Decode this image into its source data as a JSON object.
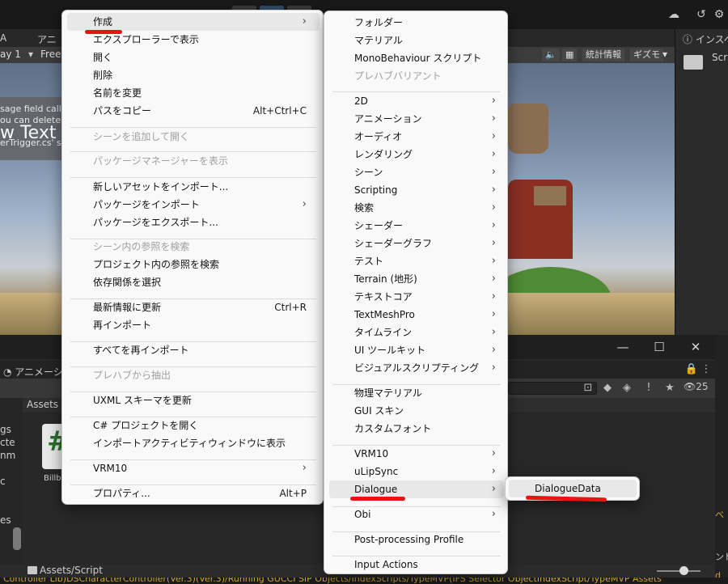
{
  "background": {
    "tabs": {
      "scene_frag": "A",
      "anim_frag": "アニ"
    },
    "gamebar": {
      "display_frag": "ay 1",
      "free_frag": "Free",
      "stats": "統計情報",
      "gizmo": "ギズモ"
    },
    "inspector": {
      "title": "インスペ",
      "script_frag": "Scr"
    },
    "scene_overlay": {
      "lines": [
        "sage field calle",
        "ou can delete i",
        "",
        "erTrigger.cs' s"
      ],
      "big_text": "w Text"
    },
    "project": {
      "anim_tab": "アニメーショ",
      "assets_label": "Assets",
      "asset_name": "Billb",
      "count": "25",
      "path": "Assets/Script",
      "left_frags": [
        "gs",
        "cte",
        "nm",
        "c",
        "es"
      ],
      "right_frags": [
        "ベ",
        "ンド",
        "d"
      ],
      "console_text": "Controller Lib)DSCharacterController(Ver.3)(Ver.3)/Running GUCCI SIP Objects/IndexScripts/TypeMVP(IFS Selector ObjectIndexScript/TypeMVP Assets"
    }
  },
  "menu_main": {
    "items": [
      {
        "label": "作成",
        "arrow": true,
        "highlight": true
      },
      {
        "label": "エクスプローラーで表示"
      },
      {
        "label": "開く"
      },
      {
        "label": "削除"
      },
      {
        "label": "名前を変更"
      },
      {
        "label": "パスをコピー",
        "shortcut": "Alt+Ctrl+C"
      },
      {
        "label": "シーンを追加して開く",
        "disabled": true
      },
      {
        "label": "パッケージマネージャーを表示",
        "disabled": true
      },
      {
        "label": "新しいアセットをインポート..."
      },
      {
        "label": "パッケージをインポート",
        "arrow": true
      },
      {
        "label": "パッケージをエクスポート..."
      },
      {
        "label": "シーン内の参照を検索",
        "disabled": true
      },
      {
        "label": "プロジェクト内の参照を検索"
      },
      {
        "label": "依存関係を選択"
      },
      {
        "label": "最新情報に更新",
        "shortcut": "Ctrl+R"
      },
      {
        "label": "再インポート"
      },
      {
        "label": "すべてを再インポート"
      },
      {
        "label": "プレハブから抽出",
        "disabled": true
      },
      {
        "label": "UXML スキーマを更新"
      },
      {
        "label": "C# プロジェクトを開く"
      },
      {
        "label": "インポートアクティビティウィンドウに表示"
      },
      {
        "label": "VRM10",
        "arrow": true
      },
      {
        "label": "プロパティ...",
        "shortcut": "Alt+P"
      }
    ]
  },
  "menu_create": {
    "items": [
      {
        "label": "フォルダー"
      },
      {
        "label": "マテリアル"
      },
      {
        "label": "MonoBehaviour スクリプト"
      },
      {
        "label": "プレハブバリアント",
        "disabled": true
      },
      {
        "label": "2D",
        "arrow": true
      },
      {
        "label": "アニメーション",
        "arrow": true
      },
      {
        "label": "オーディオ",
        "arrow": true
      },
      {
        "label": "レンダリング",
        "arrow": true
      },
      {
        "label": "シーン",
        "arrow": true
      },
      {
        "label": "Scripting",
        "arrow": true
      },
      {
        "label": "検索",
        "arrow": true
      },
      {
        "label": "シェーダー",
        "arrow": true
      },
      {
        "label": "シェーダーグラフ",
        "arrow": true
      },
      {
        "label": "テスト",
        "arrow": true
      },
      {
        "label": "Terrain (地形)",
        "arrow": true
      },
      {
        "label": "テキストコア",
        "arrow": true
      },
      {
        "label": "TextMeshPro",
        "arrow": true
      },
      {
        "label": "タイムライン",
        "arrow": true
      },
      {
        "label": "UI ツールキット",
        "arrow": true
      },
      {
        "label": "ビジュアルスクリプティング",
        "arrow": true
      },
      {
        "label": "物理マテリアル"
      },
      {
        "label": "GUI スキン"
      },
      {
        "label": "カスタムフォント"
      },
      {
        "label": "VRM10",
        "arrow": true
      },
      {
        "label": "uLipSync",
        "arrow": true
      },
      {
        "label": "Dialogue",
        "arrow": true,
        "highlight": true
      },
      {
        "label": "Obi",
        "arrow": true
      },
      {
        "label": "Post-processing Profile"
      },
      {
        "label": "Input Actions"
      }
    ]
  },
  "menu_dialogue": {
    "items": [
      {
        "label": "DialogueData"
      }
    ]
  },
  "colors": {
    "annotation_red": "#e81414",
    "menu_bg": "#f9f9f9",
    "highlight": "#e8e8e8"
  }
}
